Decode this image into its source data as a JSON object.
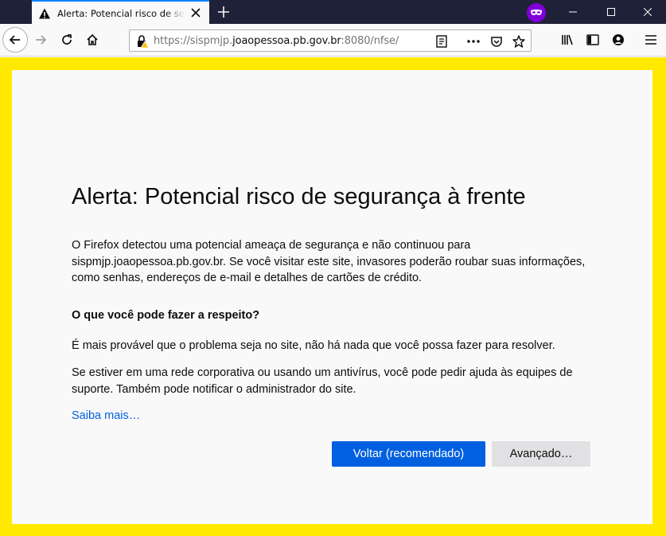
{
  "tab": {
    "title": "Alerta: Potencial risco de segurança à frente",
    "warning_icon": "warning-triangle-icon",
    "close_icon": "close-icon"
  },
  "toolbar": {
    "new_tab_icon": "plus-icon",
    "private_icon": "private-mask-icon",
    "back_icon": "back-arrow-icon",
    "forward_icon": "forward-arrow-icon",
    "reload_icon": "reload-icon",
    "home_icon": "home-icon",
    "library_icon": "library-icon",
    "sidebar_icon": "sidebar-icon",
    "account_icon": "account-icon",
    "menu_icon": "hamburger-menu-icon"
  },
  "urlbar": {
    "prefix": "https://sispmjp.",
    "domain": "joaopessoa.pb.gov.br",
    "suffix": ":8080/nfse/",
    "reader_icon": "reader-view-icon",
    "more_icon": "more-dots-icon",
    "pocket_icon": "pocket-icon",
    "bookmark_icon": "star-icon"
  },
  "page": {
    "title": "Alerta: Potencial risco de segurança à frente",
    "intro": "O Firefox detectou uma potencial ameaça de segurança e não continuou para sispmjp.joaopessoa.pb.gov.br. Se você visitar este site, invasores poderão roubar suas informações, como senhas, endereços de e-mail e detalhes de cartões de crédito.",
    "what_to_do_heading": "O que você pode fazer a respeito?",
    "what_to_do_1": "É mais provável que o problema seja no site, não há nada que você possa fazer para resolver.",
    "what_to_do_2": "Se estiver em uma rede corporativa ou usando um antivírus, você pode pedir ajuda às equipes de suporte. Também pode notificar o administrador do site.",
    "learn_more": "Saiba mais…",
    "back_button": "Voltar (recomendado)",
    "advanced_button": "Avançado…"
  },
  "colors": {
    "alert_border": "#ffe900",
    "primary_button": "#0060df",
    "link": "#0060df",
    "titlebar": "#1f2138"
  }
}
